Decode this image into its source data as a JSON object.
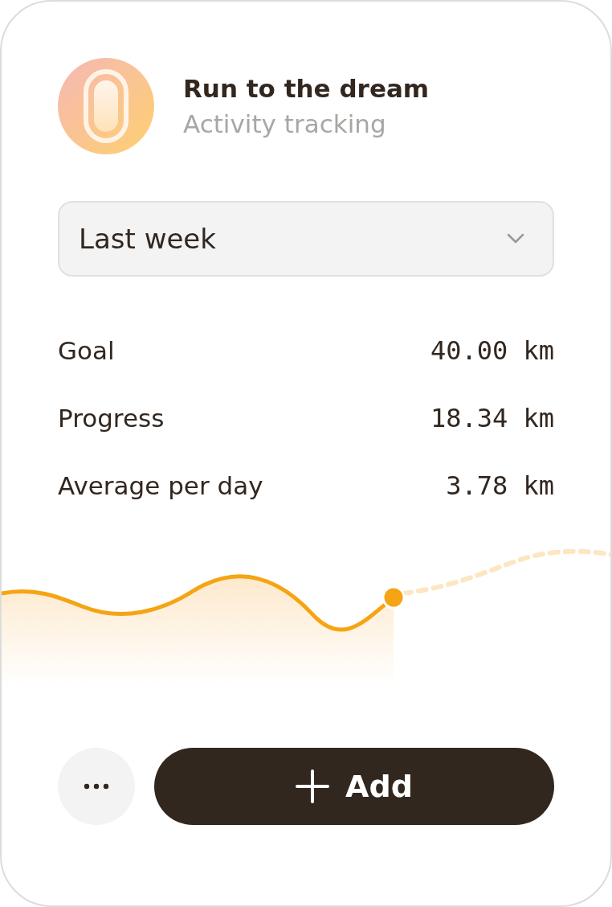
{
  "header": {
    "title": "Run to the dream",
    "subtitle": "Activity tracking"
  },
  "period_select": {
    "value": "Last week"
  },
  "stats": [
    {
      "label": "Goal",
      "value": "40.00 km"
    },
    {
      "label": "Progress",
      "value": "18.34 km"
    },
    {
      "label": "Average per day",
      "value": "3.78 km"
    }
  ],
  "actions": {
    "add_label": "Add"
  }
}
